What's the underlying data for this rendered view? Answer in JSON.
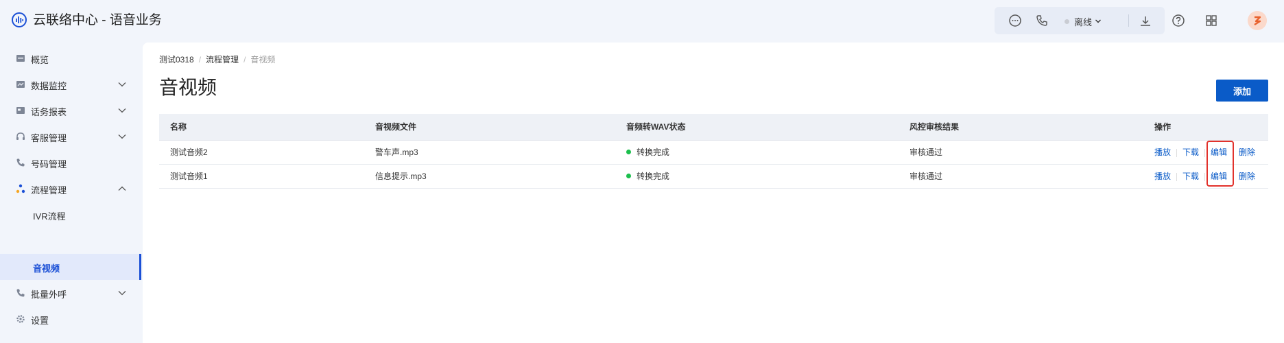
{
  "app": {
    "title": "云联络中心 - 语音业务"
  },
  "header": {
    "status_label": "离线",
    "icons": [
      "chat-icon",
      "phone-icon",
      "chevron-down-icon",
      "download-icon",
      "help-icon",
      "grid-icon"
    ]
  },
  "sidebar": {
    "items": [
      {
        "label": "概览",
        "icon": "overview-icon"
      },
      {
        "label": "数据监控",
        "icon": "monitor-icon",
        "chevron": "down"
      },
      {
        "label": "话务报表",
        "icon": "report-icon",
        "chevron": "down"
      },
      {
        "label": "客服管理",
        "icon": "headset-icon",
        "chevron": "down"
      },
      {
        "label": "号码管理",
        "icon": "phone-icon"
      },
      {
        "label": "流程管理",
        "icon": "flow-icon",
        "chevron": "up"
      },
      {
        "label": "IVR流程",
        "sub": true
      },
      {
        "label": "音视频",
        "sub": true,
        "active": true
      },
      {
        "label": "批量外呼",
        "icon": "outbound-icon",
        "chevron": "down"
      },
      {
        "label": "设置",
        "icon": "gear-icon"
      }
    ]
  },
  "breadcrumb": [
    "测试0318",
    "流程管理",
    "音视频"
  ],
  "page": {
    "title": "音视频",
    "add_label": "添加"
  },
  "table": {
    "headers": [
      "名称",
      "音视频文件",
      "音频转WAV状态",
      "风控审核结果",
      "操作"
    ],
    "rows": [
      {
        "name": "测试音频2",
        "file": "警车声.mp3",
        "status": "转换完成",
        "review": "审核通过"
      },
      {
        "name": "测试音频1",
        "file": "信息提示.mp3",
        "status": "转换完成",
        "review": "审核通过"
      }
    ],
    "actions": [
      "播放",
      "下载",
      "编辑",
      "删除"
    ]
  },
  "colors": {
    "accent": "#0a5bc8",
    "status_ok": "#1cbf4d",
    "highlight": "#e2322c",
    "sidebar_active": "#1a4fd6"
  }
}
